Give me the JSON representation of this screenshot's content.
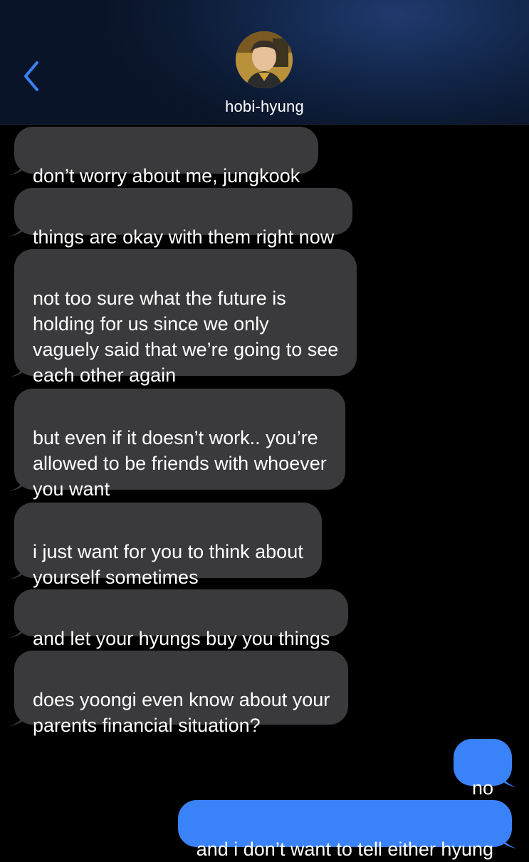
{
  "header": {
    "contact_name": "hobi-hyung",
    "back_icon": "chevron-left-icon",
    "accent_color": "#3a82f7"
  },
  "messages": [
    {
      "direction": "incoming",
      "text": "don’t worry about me, jungkook"
    },
    {
      "direction": "incoming",
      "text": "things are okay with them right now"
    },
    {
      "direction": "incoming",
      "text": "not too sure what the future is\nholding for us since we only\nvaguely said that we’re going to see\neach other again"
    },
    {
      "direction": "incoming",
      "text": "but even if it doesn’t work.. you’re\nallowed to be friends with whoever\nyou want"
    },
    {
      "direction": "incoming",
      "text": "i just want for you to think about\nyourself sometimes"
    },
    {
      "direction": "incoming",
      "text": "and let your hyungs buy you things"
    },
    {
      "direction": "incoming",
      "text": "does yoongi even know about your\nparents financial situation?"
    },
    {
      "direction": "outgoing",
      "text": "no"
    },
    {
      "direction": "outgoing",
      "text": "and i don’t want to tell either hyung"
    }
  ],
  "colors": {
    "incoming_bubble": "#3a3a3c",
    "outgoing_bubble": "#3a82f7",
    "background": "#000000"
  }
}
